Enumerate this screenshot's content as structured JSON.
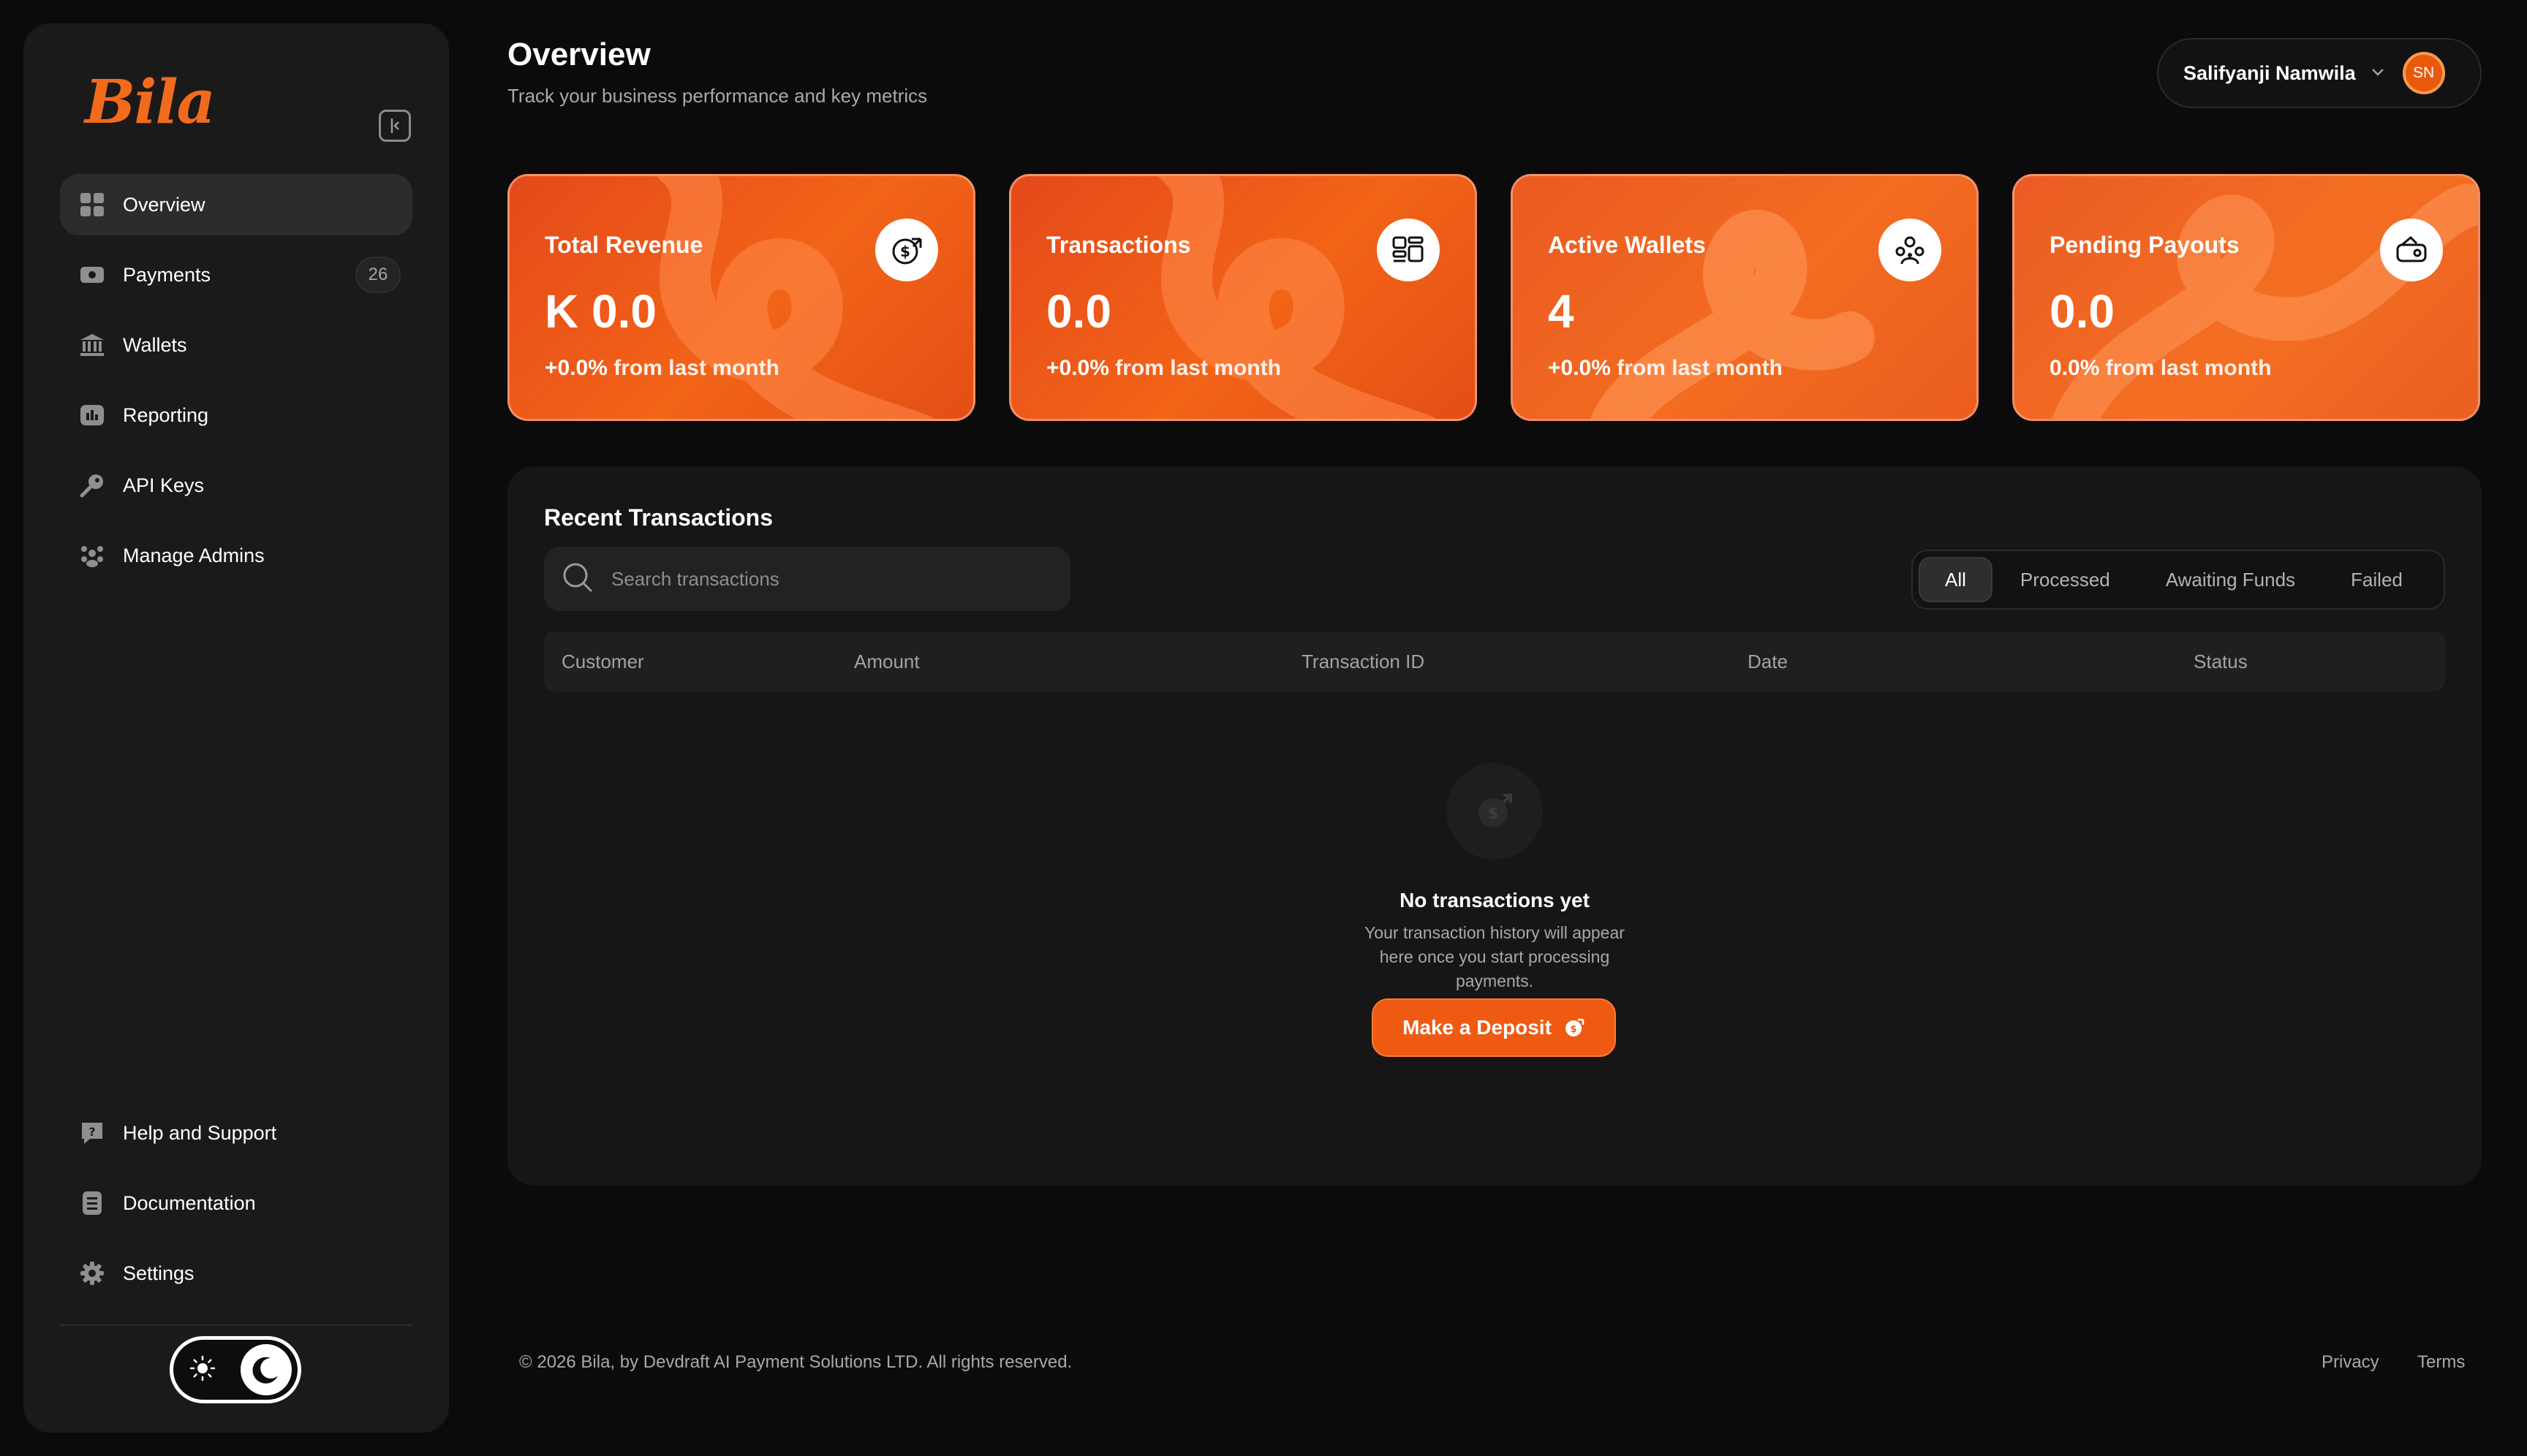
{
  "brand": {
    "logo_text": "Bila",
    "accent": "#f26b1d"
  },
  "sidebar": {
    "items": [
      {
        "label": "Overview",
        "icon": "grid-icon",
        "active": true
      },
      {
        "label": "Payments",
        "icon": "payments-icon",
        "badge": "26"
      },
      {
        "label": "Wallets",
        "icon": "bank-icon"
      },
      {
        "label": "Reporting",
        "icon": "reporting-icon"
      },
      {
        "label": "API Keys",
        "icon": "key-icon"
      },
      {
        "label": "Manage Admins",
        "icon": "users-icon"
      }
    ],
    "bottom_items": [
      {
        "label": "Help and Support",
        "icon": "help-icon"
      },
      {
        "label": "Documentation",
        "icon": "document-icon"
      },
      {
        "label": "Settings",
        "icon": "gear-icon"
      }
    ],
    "theme": "dark"
  },
  "header": {
    "title": "Overview",
    "subtitle": "Track your business performance and key metrics",
    "user_name": "Salifyanji Namwila",
    "user_initials": "SN"
  },
  "cards": [
    {
      "title": "Total Revenue",
      "value": "K 0.0",
      "change": "+0.0%",
      "change_suffix": " from last month",
      "icon": "revenue-icon"
    },
    {
      "title": "Transactions",
      "value": "0.0",
      "change": "+0.0%",
      "change_suffix": " from last month",
      "icon": "transactions-icon"
    },
    {
      "title": "Active Wallets",
      "value": "4",
      "change": "+0.0%",
      "change_suffix": " from last month",
      "icon": "wallets-group-icon"
    },
    {
      "title": "Pending Payouts",
      "value": "0.0",
      "change": "0.0%",
      "change_suffix": " from last month",
      "icon": "payout-icon"
    }
  ],
  "recent": {
    "title": "Recent Transactions",
    "search_placeholder": "Search transactions",
    "filters": [
      "All",
      "Processed",
      "Awaiting Funds",
      "Failed"
    ],
    "active_filter": "All",
    "columns": [
      "Customer",
      "Amount",
      "Transaction ID",
      "Date",
      "Status"
    ],
    "empty_title": "No transactions yet",
    "empty_desc": "Your transaction history will appear here once you start processing payments.",
    "cta": "Make a Deposit"
  },
  "footer": {
    "copyright": "© 2026 Bila, by Devdraft AI Payment Solutions LTD. All rights reserved.",
    "privacy": "Privacy",
    "terms": "Terms"
  }
}
